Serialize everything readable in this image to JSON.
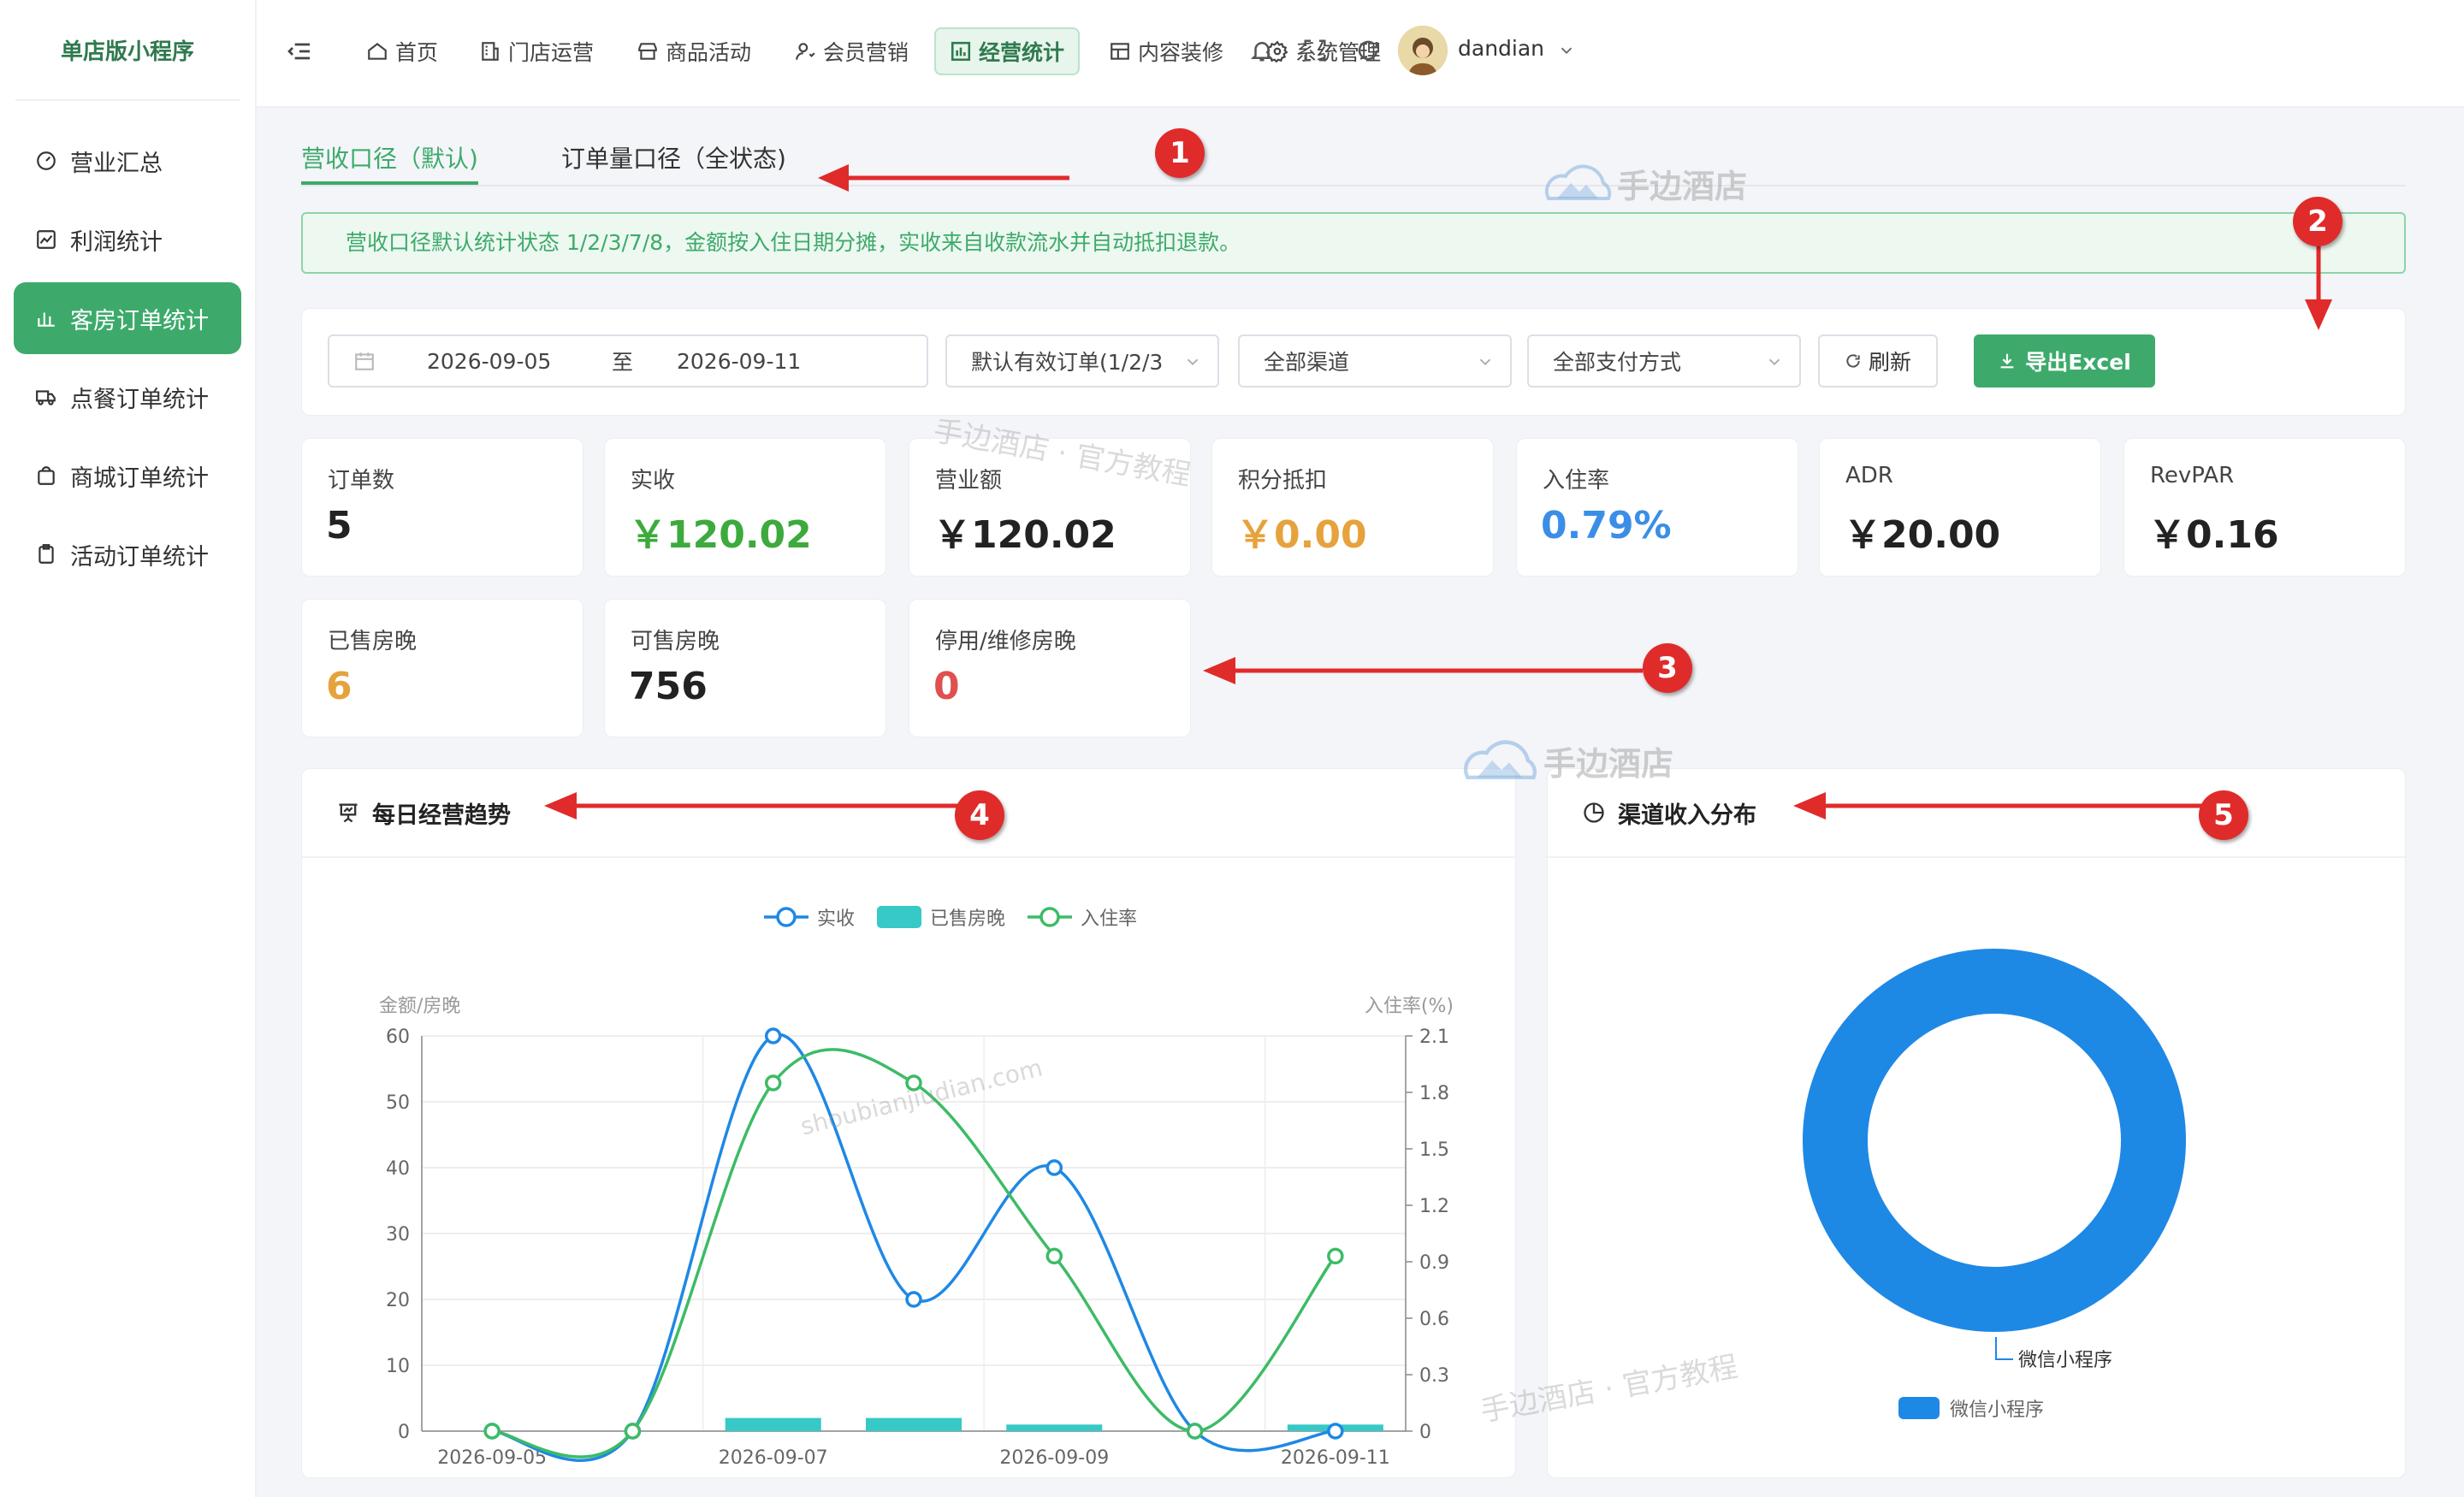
{
  "sidebar": {
    "brand": "单店版小程序",
    "items": [
      {
        "label": "营业汇总",
        "icon": "dashboard-icon"
      },
      {
        "label": "利润统计",
        "icon": "line-chart-icon"
      },
      {
        "label": "客房订单统计",
        "icon": "bar-chart-icon",
        "active": true
      },
      {
        "label": "点餐订单统计",
        "icon": "truck-icon"
      },
      {
        "label": "商城订单统计",
        "icon": "bag-icon"
      },
      {
        "label": "活动订单统计",
        "icon": "clipboard-icon"
      }
    ]
  },
  "topnav": {
    "items": [
      {
        "label": "首页",
        "icon": "home-icon"
      },
      {
        "label": "门店运营",
        "icon": "building-icon"
      },
      {
        "label": "商品活动",
        "icon": "store-icon"
      },
      {
        "label": "会员营销",
        "icon": "user-icon"
      },
      {
        "label": "经营统计",
        "icon": "chart-icon",
        "active": true
      },
      {
        "label": "内容装修",
        "icon": "layout-icon"
      },
      {
        "label": "系统管理",
        "icon": "gear-icon"
      }
    ],
    "username": "dandian"
  },
  "tabs": [
    {
      "label": "营收口径（默认)",
      "active": true
    },
    {
      "label": "订单量口径（全状态)"
    }
  ],
  "notice": "营收口径默认统计状态 1/2/3/7/8，金额按入住日期分摊，实收来自收款流水并自动抵扣退款。",
  "filters": {
    "date_start": "2026-09-05",
    "date_sep": "至",
    "date_end": "2026-09-11",
    "order_status": "默认有效订单(1/2/3",
    "channel": "全部渠道",
    "payment": "全部支付方式",
    "refresh_label": "刷新",
    "export_label": "导出Excel"
  },
  "stats": [
    {
      "label": "订单数",
      "value": "5",
      "color": "#222222"
    },
    {
      "label": "实收",
      "value": "￥120.02",
      "color": "#3daa3d"
    },
    {
      "label": "营业额",
      "value": "￥120.02",
      "color": "#222222"
    },
    {
      "label": "积分抵扣",
      "value": "￥0.00",
      "color": "#e6a23c"
    },
    {
      "label": "入住率",
      "value": "0.79%",
      "color": "#3a8ee6"
    },
    {
      "label": "ADR",
      "value": "￥20.00",
      "color": "#222222"
    },
    {
      "label": "RevPAR",
      "value": "￥0.16",
      "color": "#222222"
    },
    {
      "label": "已售房晚",
      "value": "6",
      "color": "#e6a23c"
    },
    {
      "label": "可售房晚",
      "value": "756",
      "color": "#222222"
    },
    {
      "label": "停用/维修房晚",
      "value": "0",
      "color": "#e05050"
    }
  ],
  "panels": {
    "trend_title": "每日经营趋势",
    "channel_title": "渠道收入分布"
  },
  "annotations": [
    "1",
    "2",
    "3",
    "4",
    "5"
  ],
  "watermarks": {
    "logo_text": "手边酒店",
    "text_official": "手边酒店 · 官方教程",
    "domain": "shoubianjiudian.com"
  },
  "chart_data": [
    {
      "type": "line",
      "x": [
        "2026-09-05",
        "2026-09-06",
        "2026-09-07",
        "2026-09-08",
        "2026-09-09",
        "2026-09-10",
        "2026-09-11"
      ],
      "x_tick_labels": [
        "2026-09-05",
        "2026-09-07",
        "2026-09-09",
        "2026-09-11"
      ],
      "ylabel": "金额/房晚",
      "y2label": "入住率(%)",
      "ylim": [
        0,
        60
      ],
      "y2lim": [
        0,
        2.1
      ],
      "yticks": [
        0,
        10,
        20,
        30,
        40,
        50,
        60
      ],
      "y2ticks": [
        0,
        0.3,
        0.6,
        0.9,
        1.2,
        1.5,
        1.8,
        2.1
      ],
      "legend_position": "top",
      "series": [
        {
          "name": "实收",
          "kind": "line",
          "axis": "left",
          "color": "#1e88e5",
          "values": [
            0,
            0,
            60,
            20,
            40,
            0,
            0
          ]
        },
        {
          "name": "已售房晚",
          "kind": "bar",
          "axis": "left",
          "color": "#36c9c6",
          "values": [
            0,
            0,
            2,
            2,
            1,
            0,
            1
          ]
        },
        {
          "name": "入住率",
          "kind": "line",
          "axis": "right",
          "color": "#3dbb66",
          "values": [
            0,
            0,
            1.85,
            1.85,
            0.93,
            0,
            0.93
          ]
        }
      ]
    },
    {
      "type": "pie",
      "donut": true,
      "categories": [
        "微信小程序"
      ],
      "values": [
        120.02
      ],
      "colors": [
        "#1e88e5"
      ],
      "legend_position": "bottom"
    }
  ]
}
